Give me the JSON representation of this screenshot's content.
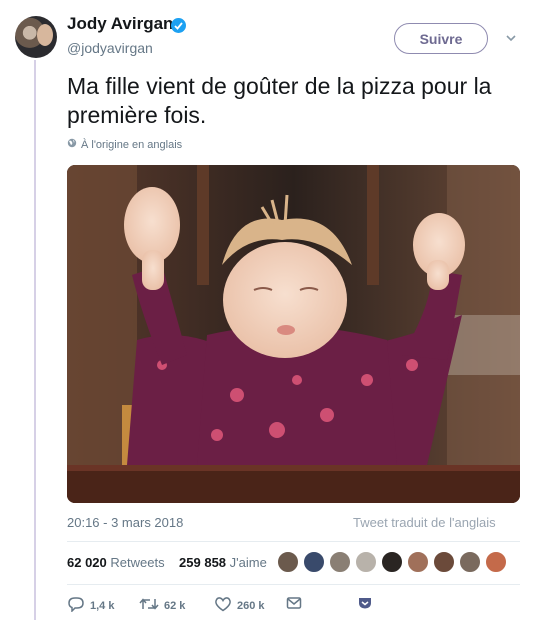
{
  "author": {
    "name": "Jody Avirgan",
    "handle": "@jodyavirgan"
  },
  "follow_label": "Suivre",
  "tweet": {
    "text": "Ma fille vient de goûter de la pizza pour la première fois."
  },
  "translation_note": "À l'origine en anglais",
  "meta": {
    "timestamp": "20:16 - 3 mars 2018",
    "translated_from": "Tweet traduit de l'anglais"
  },
  "stats": {
    "retweets_count": "62 020",
    "retweets_label": "Retweets",
    "likes_count": "259 858",
    "likes_label": "J'aime"
  },
  "actions": {
    "replies": "1,4 k",
    "retweets": "62 k",
    "likes": "260 k"
  },
  "colors": {
    "verified": "#1da1f2",
    "follow_border": "#8f8bb0",
    "dress": "#6b1f45"
  },
  "icons": [
    "verified-icon",
    "chevron-down-icon",
    "globe-icon",
    "reply-icon",
    "retweet-icon",
    "like-icon",
    "message-icon",
    "share-icon"
  ]
}
